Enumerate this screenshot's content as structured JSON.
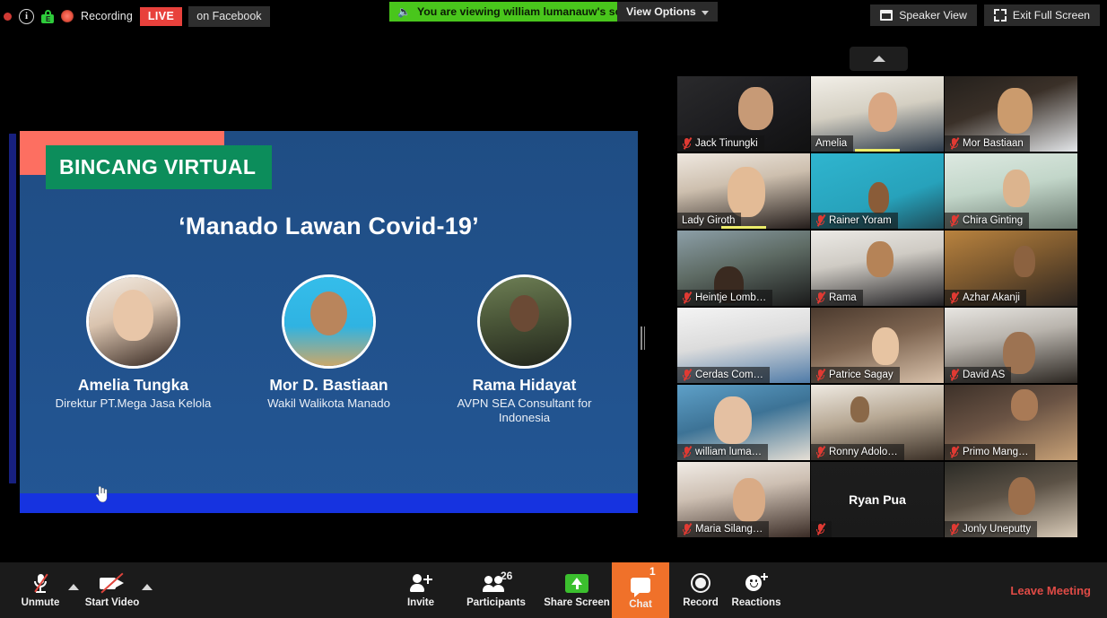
{
  "topbar": {
    "info_icon": "info-icon",
    "lock_icon": "lock-icon",
    "recording_label": "Recording",
    "live_label": "LIVE",
    "facebook_label": "on Facebook",
    "screen_share_banner": "You are viewing william lumanauw's screen",
    "speaker_glyph": "🔊",
    "view_options_label": "View Options",
    "speaker_view_label": "Speaker View",
    "exit_full_screen_label": "Exit Full Screen"
  },
  "slide": {
    "badge": "BINCANG VIRTUAL",
    "title": "‘Manado Lawan Covid-19’",
    "speakers": [
      {
        "name": "Amelia Tungka",
        "role": "Direktur PT.Mega Jasa Kelola"
      },
      {
        "name": "Mor D. Bastiaan",
        "role": "Wakil Walikota Manado"
      },
      {
        "name": "Rama Hidayat",
        "role": "AVPN SEA Consultant for Indonesia"
      }
    ],
    "colors": {
      "background": "#22518a",
      "accent_red": "#fd6f61",
      "accent_green": "#0c8d5b",
      "bottom_bar": "#1633e0"
    }
  },
  "gallery": {
    "collapse_icon": "chevron-up-icon",
    "active_border_color": "#e7ea4c",
    "tiles": [
      {
        "name": "Jack Tinungki",
        "muted": true,
        "active": false,
        "speaking": false
      },
      {
        "name": "Amelia",
        "muted": false,
        "active": false,
        "speaking": true
      },
      {
        "name": "Mor Bastiaan",
        "muted": true,
        "active": true,
        "speaking": false
      },
      {
        "name": "Lady Giroth",
        "muted": false,
        "active": false,
        "speaking": true
      },
      {
        "name": "Rainer Yoram",
        "muted": true,
        "active": false,
        "speaking": false
      },
      {
        "name": "Chira Ginting",
        "muted": true,
        "active": false,
        "speaking": false
      },
      {
        "name": "Heintje Lomb…",
        "muted": true,
        "active": false,
        "speaking": false
      },
      {
        "name": "Rama",
        "muted": true,
        "active": false,
        "speaking": false
      },
      {
        "name": "Azhar Akanji",
        "muted": true,
        "active": false,
        "speaking": false
      },
      {
        "name": "Cerdas Com…",
        "muted": true,
        "active": false,
        "speaking": false
      },
      {
        "name": "Patrice Sagay",
        "muted": true,
        "active": false,
        "speaking": false
      },
      {
        "name": "David AS",
        "muted": true,
        "active": false,
        "speaking": false
      },
      {
        "name": "william luma…",
        "muted": true,
        "active": false,
        "speaking": false
      },
      {
        "name": "Ronny Adolo…",
        "muted": true,
        "active": false,
        "speaking": false
      },
      {
        "name": "Primo Mang…",
        "muted": true,
        "active": false,
        "speaking": false
      },
      {
        "name": "Maria Silang…",
        "muted": true,
        "active": false,
        "speaking": false
      },
      {
        "name": "Ryan Pua",
        "muted": true,
        "active": false,
        "speaking": false,
        "no_video": true
      },
      {
        "name": "Jonly Uneputty",
        "muted": true,
        "active": false,
        "speaking": false
      }
    ]
  },
  "toolbar": {
    "unmute_label": "Unmute",
    "start_video_label": "Start Video",
    "invite_label": "Invite",
    "participants_label": "Participants",
    "participants_count": "26",
    "share_screen_label": "Share Screen",
    "chat_label": "Chat",
    "chat_badge": "1",
    "record_label": "Record",
    "reactions_label": "Reactions",
    "leave_label": "Leave Meeting",
    "chat_active_color": "#f0712a",
    "leave_color": "#e04b46"
  }
}
